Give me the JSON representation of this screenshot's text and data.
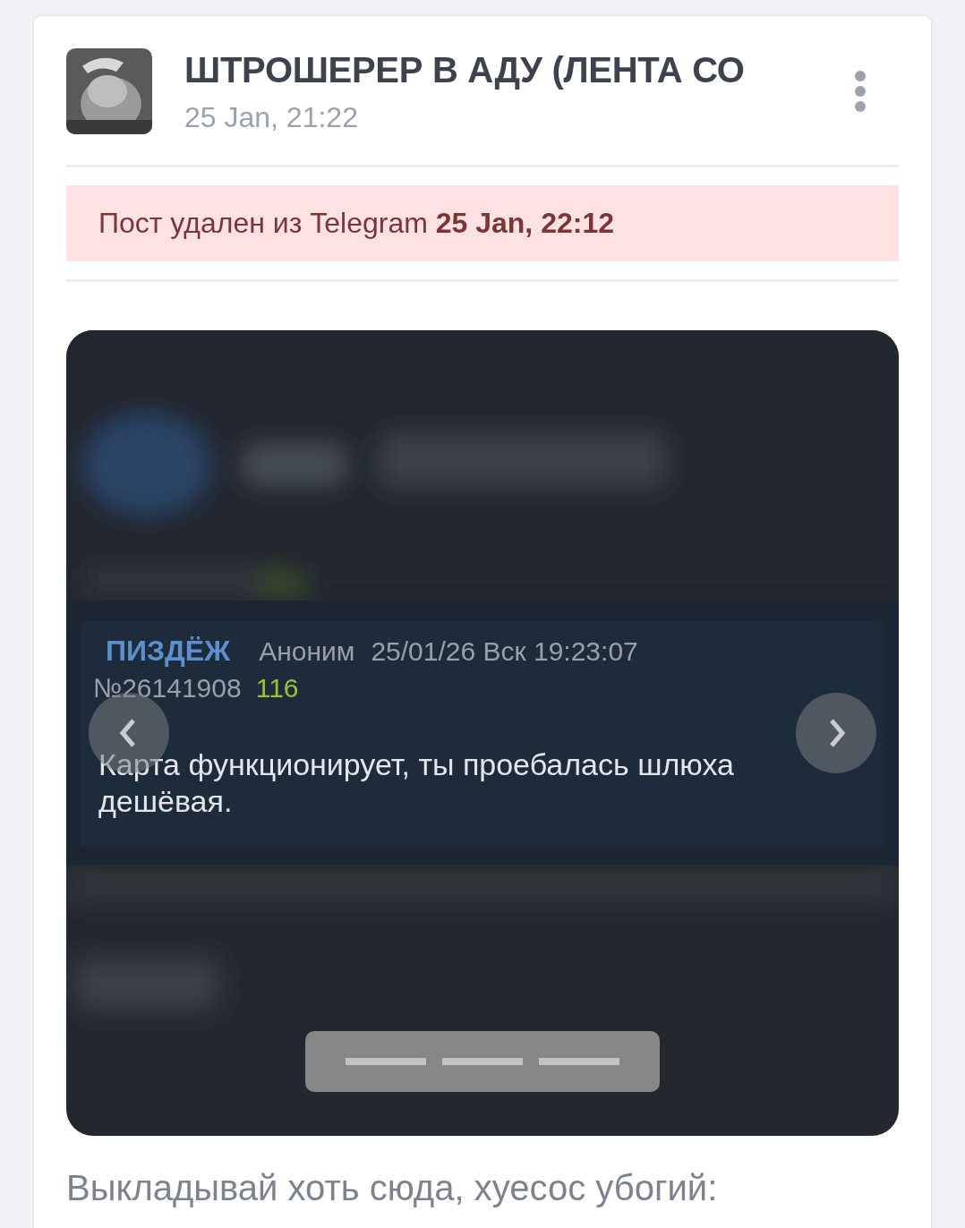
{
  "post": {
    "channel_title": "ШТРОШЕРЕР В АДУ (ЛЕНТА СО",
    "date": "25 Jan, 21:22"
  },
  "notice": {
    "text": "Пост удален из Telegram **25 Jan, 22:12**"
  },
  "slideshow": {
    "slide": {
      "kind": "screenshot",
      "board_tag": "ПИЗДЁЖ",
      "author": "Аноним",
      "timestamp": "25/01/26 Вск 19:23:07",
      "post_number": "№26141908",
      "reply_count": "116",
      "message": "Карта функционирует, ты проебалась шлюха дешёвая."
    },
    "indicators": [
      {
        "selected": false
      },
      {
        "selected": false
      },
      {
        "selected": false
      }
    ]
  },
  "caption": "Выкладывай хоть сюда, хуесос убогий:"
}
